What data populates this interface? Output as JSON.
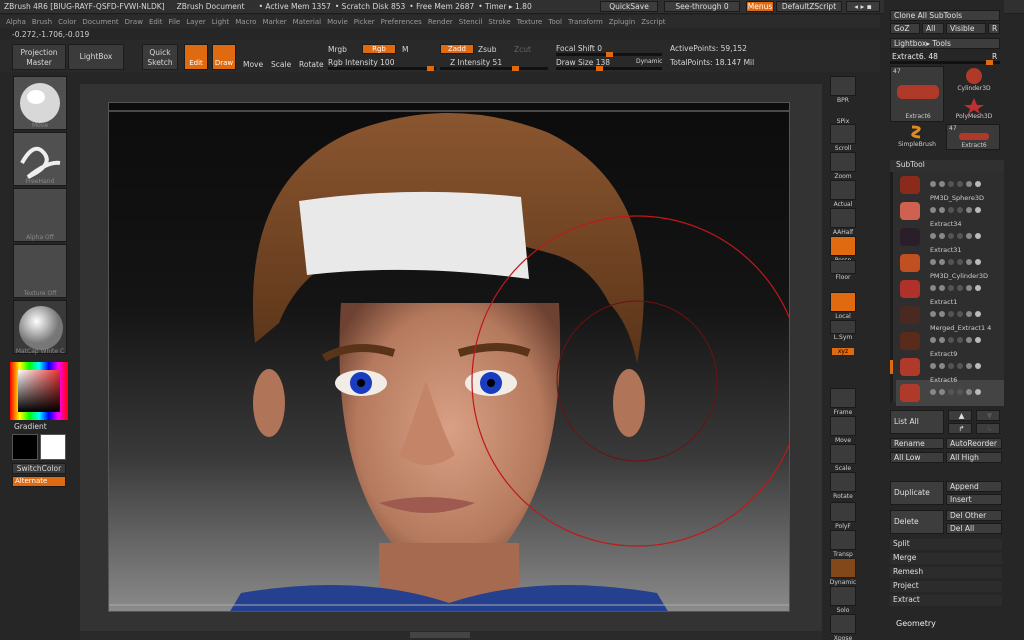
{
  "title": {
    "app": "ZBrush 4R6 [BIUG-RAYF-QSFD-FVWI-NLDK]",
    "document": "ZBrush Document",
    "active_mem": "• Active Mem 1357",
    "scratch": "• Scratch Disk 853",
    "free_mem": "• Free Mem 2687",
    "timer": "• Timer ▸ 1.80",
    "quicksave": "QuickSave",
    "see_through": "See-through 0",
    "menus": "Menus",
    "zscript": "DefaultZScript"
  },
  "menus": [
    "Alpha",
    "Brush",
    "Color",
    "Document",
    "Draw",
    "Edit",
    "File",
    "Layer",
    "Light",
    "Macro",
    "Marker",
    "Material",
    "Movie",
    "Picker",
    "Preferences",
    "Render",
    "Stencil",
    "Stroke",
    "Texture",
    "Tool",
    "Transform",
    "Zplugin",
    "Zscript"
  ],
  "coords": "-0.272,-1.706,-0.019",
  "top": {
    "projection": "Projection Master",
    "lightbox": "LightBox",
    "quick_sketch": "Quick Sketch",
    "edit": "Edit",
    "draw": "Draw",
    "move": "Move",
    "scale": "Scale",
    "rotate": "Rotate",
    "mrgb": "Mrgb",
    "rgb": "Rgb",
    "m": "M",
    "rgb_intensity": "Rgb Intensity 100",
    "zadd": "Zadd",
    "zsub": "Zsub",
    "zcut": "Zcut",
    "z_intensity": "Z Intensity 51",
    "focal_shift": "Focal Shift 0",
    "draw_size": "Draw Size 138",
    "dynamic": "Dynamic",
    "active_points": "ActivePoints: 59,152",
    "total_points": "TotalPoints: 18.147 Mil"
  },
  "left": {
    "brush": "Move",
    "stroke": "FreeHand",
    "alpha": "Alpha Off",
    "texture": "Texture Off",
    "material": "MatCap White C",
    "gradient": "Gradient",
    "switchcolor": "SwitchColor",
    "alternate": "Alternate"
  },
  "righttools": [
    "BPR",
    "SPix",
    "Scroll",
    "Zoom",
    "Actual",
    "AAHalf",
    "Persp",
    "Floor",
    "Local",
    "L.Sym",
    "xyz",
    "Frame",
    "Move",
    "Scale",
    "Rotate",
    "PolyF",
    "Transp",
    "Dynamic",
    "Solo",
    "Xpose"
  ],
  "rightpanel": {
    "clone_all": "Clone All SubTools",
    "goz": "GoZ",
    "all": "All",
    "visible": "Visible",
    "r": "R",
    "lightbox_tools": "Lightbox▸ Tools",
    "extract_current": "Extract6. 48",
    "tool_count": "47",
    "tool_count2": "47",
    "thumbs": [
      "Extract6",
      "Cylinder3D",
      "PolyMesh3D",
      "SimpleBrush",
      "Extract6"
    ],
    "subtool_title": "SubTool",
    "subtools": [
      "",
      "PM3D_Sphere3D",
      "Extract34",
      "Extract31",
      "PM3D_Cylinder3D",
      "Extract1",
      "Merged_Extract1 4",
      "Extract9",
      "Extract6"
    ],
    "list_all": "List All",
    "rename": "Rename",
    "autoreorder": "AutoReorder",
    "all_low": "All Low",
    "all_high": "All High",
    "duplicate": "Duplicate",
    "append": "Append",
    "insert": "Insert",
    "delete": "Delete",
    "del_other": "Del Other",
    "del_all": "Del All",
    "split": "Split",
    "merge": "Merge",
    "remesh": "Remesh",
    "project": "Project",
    "extract": "Extract",
    "geometry": "Geometry"
  },
  "colors": {
    "accent": "#e06a10",
    "panel": "#262626",
    "skin": "#c98a6e",
    "hair": "#7a4a2a",
    "headband": "#e8e8e8",
    "iris": "#1a3cc0"
  }
}
